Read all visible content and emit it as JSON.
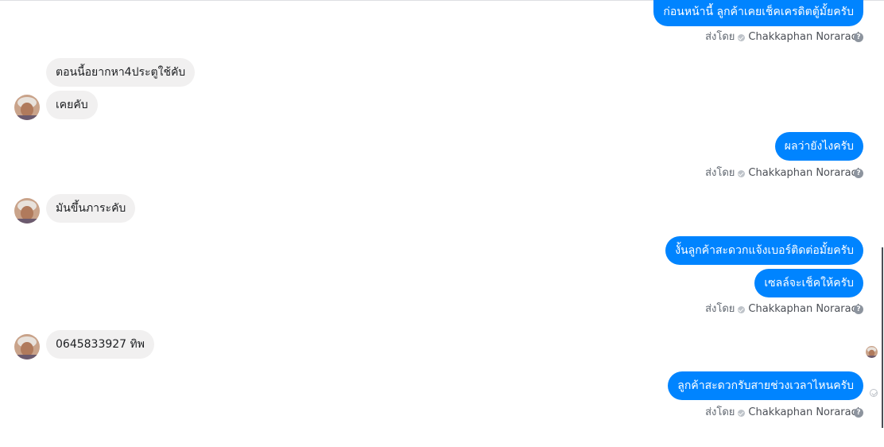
{
  "messages": {
    "out_1": "ก่อนหน้านี้ ลูกค้าเคยเช็คเครดิตตู้มั้ยครับ",
    "in_1": "ตอนนี้อยากหา4ประตูใช้คับ",
    "in_2": "เคยคับ",
    "out_2": "ผลว่ายังไงครับ",
    "in_3": "มันขึ้นภาระคับ",
    "out_3": "งั้นลูกค้าสะดวกแจ้งเบอร์ติดต่อมั้ยครับ",
    "out_4": "เซลล์จะเช็คให้ครับ",
    "in_4": "0645833927  ทิพ",
    "out_5": "ลูกค้าสะดวกรับสายช่วงเวลาไหนครับ"
  },
  "sent_by": {
    "prefix": "ส่งโดย",
    "name": "Chakkaphan Norarach",
    "help_glyph": "?"
  },
  "colors": {
    "outgoing_bubble": "#0084ff",
    "incoming_bubble": "#f1f0f0"
  },
  "icons": {
    "verified": "verified-check-icon",
    "help": "help-icon",
    "delivered": "delivered-check-icon"
  }
}
